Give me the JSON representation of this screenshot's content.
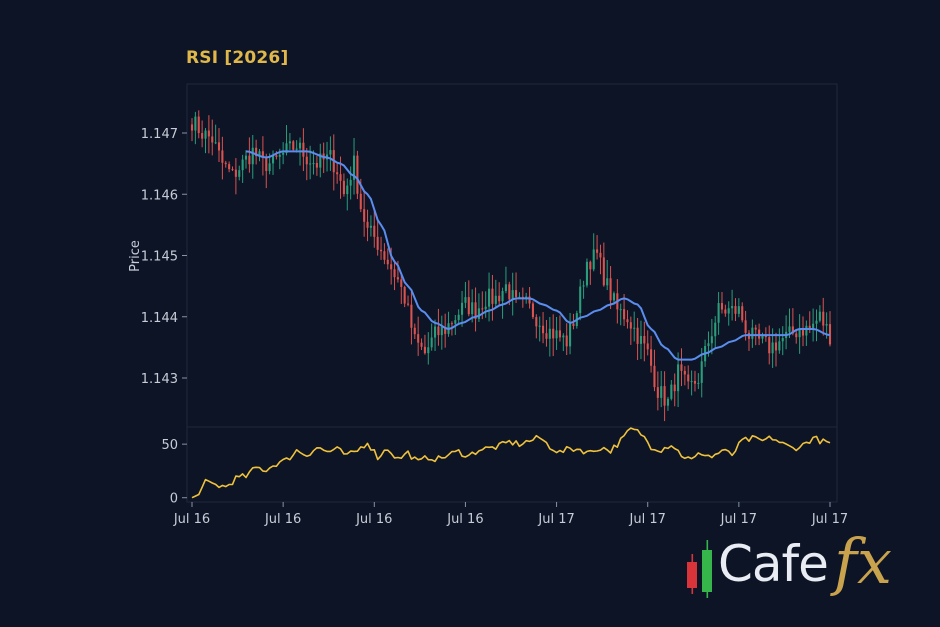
{
  "chart_data": [
    {
      "panel": "price",
      "type": "candlestick",
      "title": "RSI [2026]",
      "ylabel": "Price",
      "xlabel": "",
      "ylim": [
        1.1422,
        1.1478
      ],
      "yticks": [
        1.143,
        1.144,
        1.145,
        1.146,
        1.147
      ],
      "xticks": [
        "Jul 16",
        "Jul 16",
        "Jul 16",
        "Jul 16",
        "Jul 17",
        "Jul 17",
        "Jul 17",
        "Jul 17"
      ],
      "grid": false,
      "candle_up_color": "#2a9d7a",
      "candle_down_color": "#d9534f",
      "moving_average_color": "#5b8def",
      "close_anchors": [
        [
          0,
          1.1472
        ],
        [
          3,
          1.147
        ],
        [
          6,
          1.1469
        ],
        [
          9,
          1.1465
        ],
        [
          12,
          1.1463
        ],
        [
          15,
          1.1465
        ],
        [
          18,
          1.1467
        ],
        [
          21,
          1.1465
        ],
        [
          24,
          1.1465
        ],
        [
          28,
          1.1467
        ],
        [
          31,
          1.1468
        ],
        [
          34,
          1.1466
        ],
        [
          37,
          1.1465
        ],
        [
          41,
          1.1466
        ],
        [
          43,
          1.1464
        ],
        [
          45,
          1.146
        ],
        [
          48,
          1.1465
        ],
        [
          50,
          1.1458
        ],
        [
          52,
          1.1454
        ],
        [
          54,
          1.1453
        ],
        [
          57,
          1.145
        ],
        [
          59,
          1.1448
        ],
        [
          61,
          1.1446
        ],
        [
          63,
          1.1443
        ],
        [
          66,
          1.1436
        ],
        [
          69,
          1.1434
        ],
        [
          72,
          1.1437
        ],
        [
          75,
          1.1438
        ],
        [
          78,
          1.144
        ],
        [
          81,
          1.1442
        ],
        [
          84,
          1.1441
        ],
        [
          87,
          1.1443
        ],
        [
          90,
          1.1443
        ],
        [
          93,
          1.1445
        ],
        [
          96,
          1.1442
        ],
        [
          99,
          1.1442
        ],
        [
          102,
          1.144
        ],
        [
          105,
          1.1438
        ],
        [
          108,
          1.1437
        ],
        [
          111,
          1.1436
        ],
        [
          114,
          1.1441
        ],
        [
          117,
          1.1449
        ],
        [
          120,
          1.145
        ],
        [
          123,
          1.1445
        ],
        [
          126,
          1.1441
        ],
        [
          129,
          1.144
        ],
        [
          132,
          1.1437
        ],
        [
          135,
          1.1434
        ],
        [
          138,
          1.1428
        ],
        [
          141,
          1.1426
        ],
        [
          144,
          1.1431
        ],
        [
          147,
          1.1428
        ],
        [
          150,
          1.143
        ],
        [
          153,
          1.1436
        ],
        [
          156,
          1.1441
        ],
        [
          159,
          1.1441
        ],
        [
          162,
          1.1441
        ],
        [
          165,
          1.1437
        ],
        [
          168,
          1.1436
        ],
        [
          171,
          1.1435
        ],
        [
          174,
          1.1436
        ],
        [
          177,
          1.1437
        ],
        [
          180,
          1.1438
        ],
        [
          183,
          1.1438
        ],
        [
          186,
          1.144
        ],
        [
          189,
          1.1437
        ]
      ],
      "ma_anchors": [
        [
          16,
          1.1467
        ],
        [
          22,
          1.1466
        ],
        [
          27,
          1.1467
        ],
        [
          34,
          1.1467
        ],
        [
          40,
          1.1466
        ],
        [
          44,
          1.1465
        ],
        [
          48,
          1.1463
        ],
        [
          52,
          1.146
        ],
        [
          56,
          1.1455
        ],
        [
          60,
          1.1449
        ],
        [
          64,
          1.1445
        ],
        [
          68,
          1.1441
        ],
        [
          72,
          1.1439
        ],
        [
          76,
          1.1438
        ],
        [
          80,
          1.1439
        ],
        [
          84,
          1.144
        ],
        [
          88,
          1.1441
        ],
        [
          92,
          1.1442
        ],
        [
          96,
          1.1443
        ],
        [
          100,
          1.1443
        ],
        [
          104,
          1.1442
        ],
        [
          108,
          1.1441
        ],
        [
          112,
          1.1439
        ],
        [
          116,
          1.144
        ],
        [
          120,
          1.1441
        ],
        [
          124,
          1.1442
        ],
        [
          128,
          1.1443
        ],
        [
          132,
          1.1442
        ],
        [
          136,
          1.1438
        ],
        [
          140,
          1.1435
        ],
        [
          144,
          1.1433
        ],
        [
          148,
          1.1433
        ],
        [
          152,
          1.1434
        ],
        [
          156,
          1.1435
        ],
        [
          160,
          1.1436
        ],
        [
          164,
          1.1437
        ],
        [
          168,
          1.1437
        ],
        [
          172,
          1.1437
        ],
        [
          176,
          1.1437
        ],
        [
          180,
          1.1438
        ],
        [
          184,
          1.1438
        ],
        [
          189,
          1.1437
        ]
      ]
    },
    {
      "panel": "rsi",
      "type": "line",
      "ylim": [
        -4,
        66
      ],
      "yticks": [
        0,
        50
      ],
      "line_color": "#f0c23b",
      "anchors": [
        [
          0,
          0
        ],
        [
          2,
          3
        ],
        [
          4,
          14
        ],
        [
          7,
          12
        ],
        [
          10,
          10
        ],
        [
          13,
          18
        ],
        [
          16,
          20
        ],
        [
          19,
          28
        ],
        [
          22,
          26
        ],
        [
          25,
          32
        ],
        [
          28,
          35
        ],
        [
          31,
          44
        ],
        [
          34,
          40
        ],
        [
          37,
          47
        ],
        [
          40,
          43
        ],
        [
          43,
          45
        ],
        [
          46,
          39
        ],
        [
          49,
          44
        ],
        [
          52,
          52
        ],
        [
          55,
          38
        ],
        [
          58,
          46
        ],
        [
          61,
          36
        ],
        [
          64,
          42
        ],
        [
          67,
          33
        ],
        [
          70,
          38
        ],
        [
          73,
          36
        ],
        [
          76,
          40
        ],
        [
          79,
          43
        ],
        [
          82,
          39
        ],
        [
          85,
          45
        ],
        [
          88,
          46
        ],
        [
          91,
          48
        ],
        [
          94,
          52
        ],
        [
          97,
          50
        ],
        [
          100,
          53
        ],
        [
          103,
          56
        ],
        [
          106,
          48
        ],
        [
          109,
          42
        ],
        [
          112,
          46
        ],
        [
          115,
          45
        ],
        [
          118,
          42
        ],
        [
          121,
          47
        ],
        [
          124,
          44
        ],
        [
          127,
          53
        ],
        [
          130,
          64
        ],
        [
          133,
          60
        ],
        [
          136,
          48
        ],
        [
          139,
          45
        ],
        [
          142,
          50
        ],
        [
          145,
          40
        ],
        [
          148,
          35
        ],
        [
          151,
          42
        ],
        [
          154,
          38
        ],
        [
          157,
          44
        ],
        [
          160,
          40
        ],
        [
          163,
          53
        ],
        [
          166,
          55
        ],
        [
          169,
          53
        ],
        [
          172,
          56
        ],
        [
          175,
          50
        ],
        [
          178,
          46
        ],
        [
          181,
          49
        ],
        [
          184,
          56
        ],
        [
          187,
          52
        ],
        [
          189,
          51
        ]
      ]
    }
  ],
  "brand": {
    "name_part_1": "Cafe",
    "name_part_2": "fx",
    "red": "#d9343a",
    "green": "#35b54a",
    "gold": "#c9a24e"
  }
}
